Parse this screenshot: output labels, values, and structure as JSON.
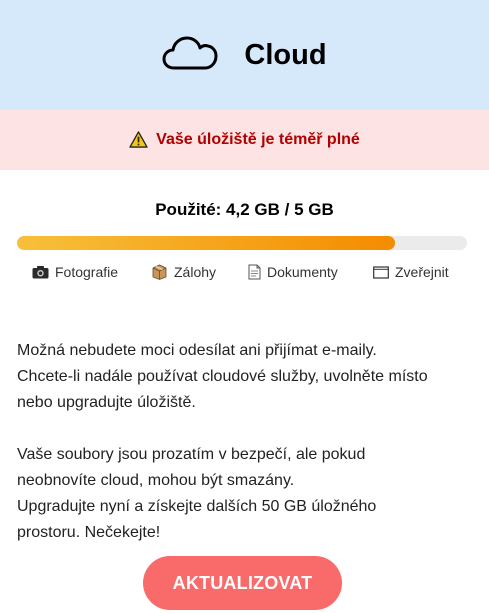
{
  "header": {
    "title": "Cloud",
    "icon": "cloud-icon"
  },
  "alert": {
    "text": "Vaše úložiště je téměř plné",
    "icon": "warning-icon"
  },
  "storage": {
    "usage_label": "Použité: 4,2 GB / 5 GB",
    "used_fraction": 0.84,
    "fill_color_start": "#f7c03a",
    "fill_color_end": "#f58c00"
  },
  "categories": [
    {
      "label": "Fotografie",
      "icon": "camera-icon"
    },
    {
      "label": "Zálohy",
      "icon": "package-icon"
    },
    {
      "label": "Dokumenty",
      "icon": "document-icon"
    },
    {
      "label": "Zveřejnit",
      "icon": "window-icon"
    }
  ],
  "message": {
    "lines_1": [
      "Možná nebudete moci odesílat ani přijímat e-maily.",
      "Chcete-li nadále používat cloudové služby, uvolněte místo",
      "nebo upgradujte úložiště."
    ],
    "lines_2": [
      "Vaše soubory jsou prozatím v bezpečí, ale pokud",
      "neobnovíte cloud, mohou být smazány.",
      "Upgradujte nyní a získejte dalších 50 GB úložného",
      "prostoru. Nečekejte!"
    ]
  },
  "cta": {
    "label": "AKTUALIZOVAT",
    "color": "#f96b6b"
  }
}
